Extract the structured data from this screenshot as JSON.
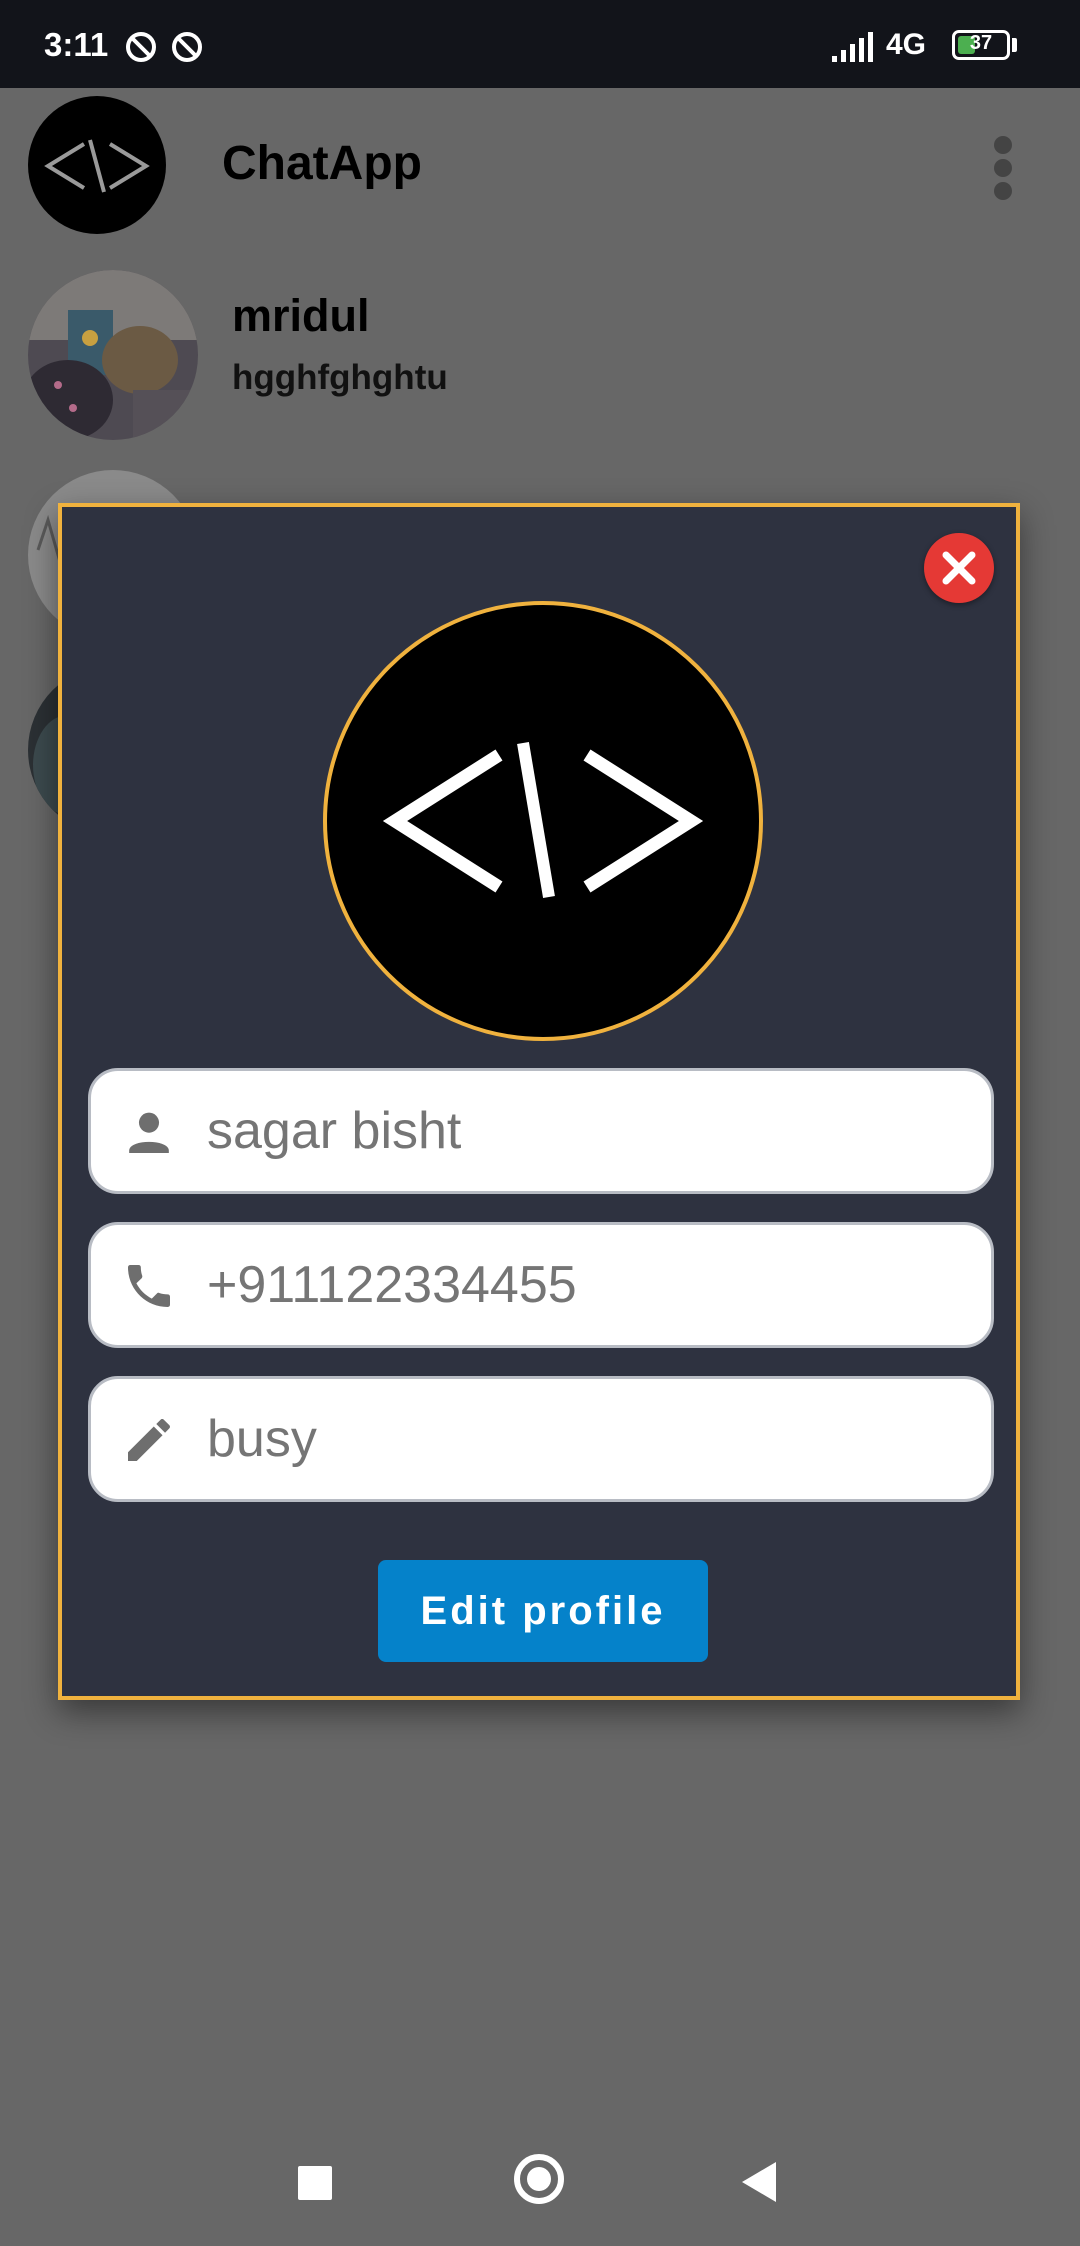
{
  "status_bar": {
    "time": "3:11",
    "network": "4G",
    "battery_level": "37",
    "battery_fraction": 0.37,
    "icons": [
      "dnd-icon",
      "dnd-icon",
      "signal-icon",
      "battery-icon"
    ]
  },
  "app_bar": {
    "title": "ChatApp",
    "logo_glyph": "<\\>",
    "menu_icon": "more-vert-icon"
  },
  "chats": [
    {
      "name": "mridul",
      "last_message": "hgghfghghtu"
    }
  ],
  "profile_dialog": {
    "avatar_glyph": "<\\>",
    "close_icon": "close-icon",
    "fields": {
      "name": {
        "icon": "person-icon",
        "value": "sagar bisht"
      },
      "phone": {
        "icon": "phone-icon",
        "value": "+911122334455"
      },
      "status": {
        "icon": "pencil-icon",
        "value": "busy"
      }
    },
    "edit_button_label": "Edit profile"
  },
  "nav_bar": {
    "icons": [
      "recent-apps-icon",
      "home-icon",
      "back-icon"
    ]
  },
  "colors": {
    "scrim": "#676767",
    "status_bar": "#12141a",
    "dialog_background": "#2e3240",
    "dialog_border": "#f0b23e",
    "close_button": "#e53935",
    "edit_button": "#0582ca",
    "field_text": "#757575"
  }
}
